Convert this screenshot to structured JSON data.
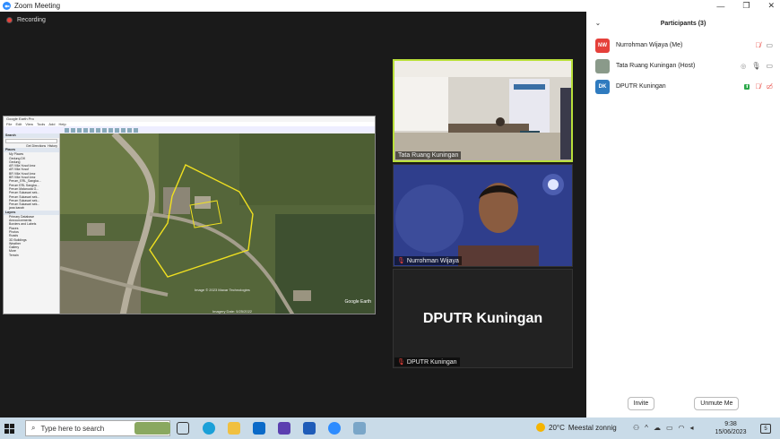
{
  "window": {
    "title": "Zoom Meeting",
    "min": "—",
    "max": "❐",
    "close": "✕"
  },
  "recording": {
    "label": "Recording"
  },
  "share": {
    "app_title": "Google Earth Pro",
    "menu": [
      "File",
      "Edit",
      "View",
      "Tools",
      "Add",
      "Help"
    ],
    "search_header": "Search",
    "search_links": [
      "Get Directions",
      "History"
    ],
    "places_header": "Places",
    "places": [
      "My Places",
      "Gedung DK",
      "Gedung",
      "AR Villa Yusuf.kmz",
      "AR Villa Yusuf",
      "BR Villa Yusuf.kmz",
      "BR Villa Yusuf.kmz",
      "Perum_ERL_Sangka...",
      "Perum ERL Sangka...",
      "Perum Malanuda G...",
      "Perum Sukasari sek...",
      "Perum Sukasari sek...",
      "Perum Sukasari sek...",
      "Perum Sukasari sek...",
      "jana kanah"
    ],
    "layers_header": "Layers",
    "layers": [
      "Primary Database",
      "Announcements",
      "Borders and Labels",
      "Places",
      "Photos",
      "Roads",
      "3D Buildings",
      "Weather",
      "Gallery",
      "More",
      "Terrain"
    ],
    "map_image_credit": "Image © 2023 Maxar Technologies",
    "map_footer": "Imagery Date: 5/25/2022",
    "map_logo": "Google Earth"
  },
  "tiles": [
    {
      "name": "Tata Ruang Kuningan",
      "muted": false
    },
    {
      "name": "Nurrohman Wijaya",
      "muted": true
    },
    {
      "name": "DPUTR Kuningan",
      "display": "DPUTR Kuningan",
      "muted": true
    }
  ],
  "panel": {
    "title": "Participants (3)",
    "chevron": "⌄",
    "participants": [
      {
        "initials": "NW",
        "name": "Nurrohman Wijaya (Me)",
        "color": "#e5403a"
      },
      {
        "initials": "",
        "name": "Tata Ruang Kuningan (Host)",
        "color": "#8a9a8a"
      },
      {
        "initials": "DK",
        "name": "DPUTR Kuningan",
        "color": "#2f7bbf"
      }
    ],
    "invite": "Invite",
    "unmute": "Unmute Me"
  },
  "taskbar": {
    "search_placeholder": "Type here to search",
    "temperature": "20°C",
    "weather": "Meestal zonnig",
    "time": "9:38",
    "date": "15/06/2023",
    "notifications": "5"
  },
  "colors": {
    "accent": "#2d8cff",
    "muted": "#e8413a",
    "active_border": "#b9e03a"
  }
}
